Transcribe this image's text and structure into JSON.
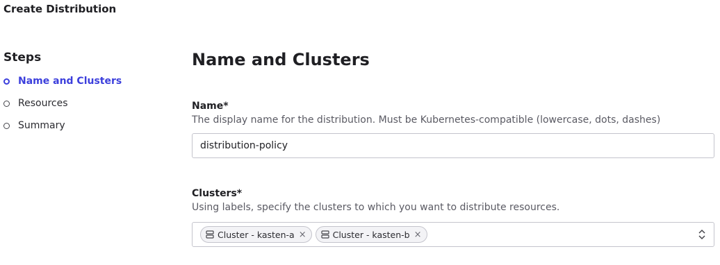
{
  "page": {
    "title": "Create Distribution"
  },
  "steps": {
    "heading": "Steps",
    "items": [
      {
        "label": "Name and Clusters",
        "active": true
      },
      {
        "label": "Resources",
        "active": false
      },
      {
        "label": "Summary",
        "active": false
      }
    ]
  },
  "main": {
    "section_title": "Name and Clusters",
    "name_field": {
      "label": "Name*",
      "help": "The display name for the distribution. Must be Kubernetes-compatible (lowercase, dots, dashes)",
      "value": "distribution-policy"
    },
    "clusters_field": {
      "label": "Clusters*",
      "help": "Using labels, specify the clusters to which you want to distribute resources.",
      "chips": [
        {
          "label": "Cluster - kasten-a",
          "icon": "server-icon",
          "remove": "×"
        },
        {
          "label": "Cluster - kasten-b",
          "icon": "server-icon",
          "remove": "×"
        }
      ],
      "caret_icon": "chevron-up-down-icon"
    }
  },
  "colors": {
    "accent": "#3c3fdc",
    "border": "#c4c4cc",
    "text": "#1f1f23",
    "muted": "#5a5a63"
  }
}
